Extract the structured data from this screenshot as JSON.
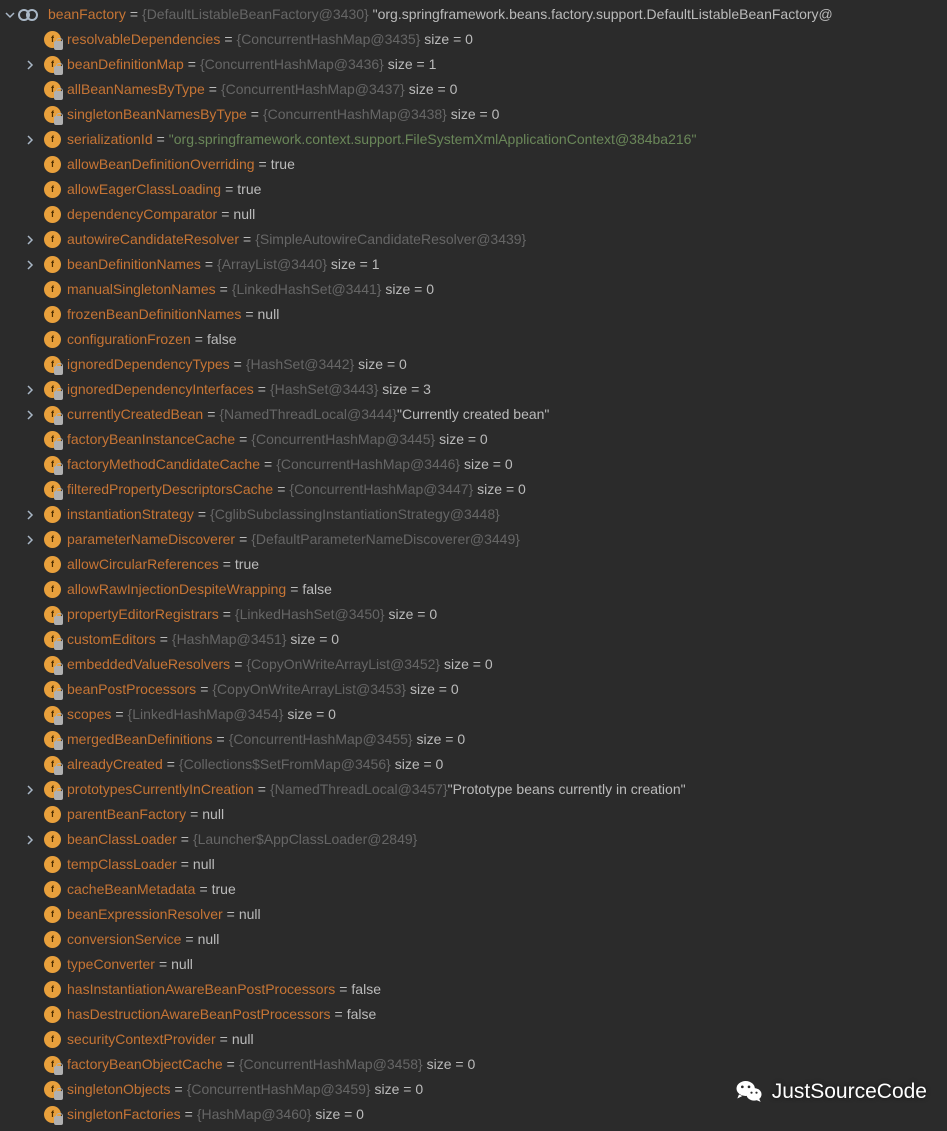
{
  "watermark": "JustSourceCode",
  "root": {
    "name": "beanFactory",
    "ref": "{DefaultListableBeanFactory@3430}",
    "str": "\"org.springframework.beans.factory.support.DefaultListableBeanFactory@"
  },
  "rows": [
    {
      "indent": 42,
      "arrow": false,
      "icon": "fl",
      "name": "resolvableDependencies",
      "ref": "{ConcurrentHashMap@3435}",
      "size": "size = 0"
    },
    {
      "indent": 42,
      "arrow": true,
      "icon": "fl",
      "name": "beanDefinitionMap",
      "ref": "{ConcurrentHashMap@3436}",
      "size": "size = 1"
    },
    {
      "indent": 42,
      "arrow": false,
      "icon": "fl",
      "name": "allBeanNamesByType",
      "ref": "{ConcurrentHashMap@3437}",
      "size": "size = 0"
    },
    {
      "indent": 42,
      "arrow": false,
      "icon": "fl",
      "name": "singletonBeanNamesByType",
      "ref": "{ConcurrentHashMap@3438}",
      "size": "size = 0"
    },
    {
      "indent": 42,
      "arrow": true,
      "icon": "f",
      "name": "serializationId",
      "str": "\"org.springframework.context.support.FileSystemXmlApplicationContext@384ba216\""
    },
    {
      "indent": 42,
      "arrow": false,
      "icon": "f",
      "name": "allowBeanDefinitionOverriding",
      "val": "true"
    },
    {
      "indent": 42,
      "arrow": false,
      "icon": "f",
      "name": "allowEagerClassLoading",
      "val": "true"
    },
    {
      "indent": 42,
      "arrow": false,
      "icon": "f",
      "name": "dependencyComparator",
      "val": "null"
    },
    {
      "indent": 42,
      "arrow": true,
      "icon": "f",
      "name": "autowireCandidateResolver",
      "ref": "{SimpleAutowireCandidateResolver@3439}"
    },
    {
      "indent": 42,
      "arrow": true,
      "icon": "f",
      "name": "beanDefinitionNames",
      "ref": "{ArrayList@3440}",
      "size": "size = 1"
    },
    {
      "indent": 42,
      "arrow": false,
      "icon": "f",
      "name": "manualSingletonNames",
      "ref": "{LinkedHashSet@3441}",
      "size": "size = 0"
    },
    {
      "indent": 42,
      "arrow": false,
      "icon": "f",
      "name": "frozenBeanDefinitionNames",
      "val": "null"
    },
    {
      "indent": 42,
      "arrow": false,
      "icon": "f",
      "name": "configurationFrozen",
      "val": "false"
    },
    {
      "indent": 42,
      "arrow": false,
      "icon": "fl",
      "name": "ignoredDependencyTypes",
      "ref": "{HashSet@3442}",
      "size": "size = 0"
    },
    {
      "indent": 42,
      "arrow": true,
      "icon": "fl",
      "name": "ignoredDependencyInterfaces",
      "ref": "{HashSet@3443}",
      "size": "size = 3"
    },
    {
      "indent": 42,
      "arrow": true,
      "icon": "fl",
      "name": "currentlyCreatedBean",
      "ref": "{NamedThreadLocal@3444}",
      "strgrey": "\"Currently created bean\""
    },
    {
      "indent": 42,
      "arrow": false,
      "icon": "fl",
      "name": "factoryBeanInstanceCache",
      "ref": "{ConcurrentHashMap@3445}",
      "size": "size = 0"
    },
    {
      "indent": 42,
      "arrow": false,
      "icon": "fl",
      "name": "factoryMethodCandidateCache",
      "ref": "{ConcurrentHashMap@3446}",
      "size": "size = 0"
    },
    {
      "indent": 42,
      "arrow": false,
      "icon": "fl",
      "name": "filteredPropertyDescriptorsCache",
      "ref": "{ConcurrentHashMap@3447}",
      "size": "size = 0"
    },
    {
      "indent": 42,
      "arrow": true,
      "icon": "f",
      "name": "instantiationStrategy",
      "ref": "{CglibSubclassingInstantiationStrategy@3448}"
    },
    {
      "indent": 42,
      "arrow": true,
      "icon": "f",
      "name": "parameterNameDiscoverer",
      "ref": "{DefaultParameterNameDiscoverer@3449}"
    },
    {
      "indent": 42,
      "arrow": false,
      "icon": "f",
      "name": "allowCircularReferences",
      "val": "true"
    },
    {
      "indent": 42,
      "arrow": false,
      "icon": "f",
      "name": "allowRawInjectionDespiteWrapping",
      "val": "false"
    },
    {
      "indent": 42,
      "arrow": false,
      "icon": "fl",
      "name": "propertyEditorRegistrars",
      "ref": "{LinkedHashSet@3450}",
      "size": "size = 0"
    },
    {
      "indent": 42,
      "arrow": false,
      "icon": "fl",
      "name": "customEditors",
      "ref": "{HashMap@3451}",
      "size": "size = 0"
    },
    {
      "indent": 42,
      "arrow": false,
      "icon": "fl",
      "name": "embeddedValueResolvers",
      "ref": "{CopyOnWriteArrayList@3452}",
      "size": "size = 0"
    },
    {
      "indent": 42,
      "arrow": false,
      "icon": "fl",
      "name": "beanPostProcessors",
      "ref": "{CopyOnWriteArrayList@3453}",
      "size": "size = 0"
    },
    {
      "indent": 42,
      "arrow": false,
      "icon": "fl",
      "name": "scopes",
      "ref": "{LinkedHashMap@3454}",
      "size": "size = 0"
    },
    {
      "indent": 42,
      "arrow": false,
      "icon": "fl",
      "name": "mergedBeanDefinitions",
      "ref": "{ConcurrentHashMap@3455}",
      "size": "size = 0"
    },
    {
      "indent": 42,
      "arrow": false,
      "icon": "fl",
      "name": "alreadyCreated",
      "ref": "{Collections$SetFromMap@3456}",
      "size": "size = 0"
    },
    {
      "indent": 42,
      "arrow": true,
      "icon": "fl",
      "name": "prototypesCurrentlyInCreation",
      "ref": "{NamedThreadLocal@3457}",
      "strgrey": "\"Prototype beans currently in creation\""
    },
    {
      "indent": 42,
      "arrow": false,
      "icon": "f",
      "name": "parentBeanFactory",
      "val": "null"
    },
    {
      "indent": 42,
      "arrow": true,
      "icon": "f",
      "name": "beanClassLoader",
      "ref": "{Launcher$AppClassLoader@2849}"
    },
    {
      "indent": 42,
      "arrow": false,
      "icon": "f",
      "name": "tempClassLoader",
      "val": "null"
    },
    {
      "indent": 42,
      "arrow": false,
      "icon": "f",
      "name": "cacheBeanMetadata",
      "val": "true"
    },
    {
      "indent": 42,
      "arrow": false,
      "icon": "f",
      "name": "beanExpressionResolver",
      "val": "null"
    },
    {
      "indent": 42,
      "arrow": false,
      "icon": "f",
      "name": "conversionService",
      "val": "null"
    },
    {
      "indent": 42,
      "arrow": false,
      "icon": "f",
      "name": "typeConverter",
      "val": "null"
    },
    {
      "indent": 42,
      "arrow": false,
      "icon": "f",
      "name": "hasInstantiationAwareBeanPostProcessors",
      "val": "false"
    },
    {
      "indent": 42,
      "arrow": false,
      "icon": "f",
      "name": "hasDestructionAwareBeanPostProcessors",
      "val": "false"
    },
    {
      "indent": 42,
      "arrow": false,
      "icon": "f",
      "name": "securityContextProvider",
      "val": "null"
    },
    {
      "indent": 42,
      "arrow": false,
      "icon": "fl",
      "name": "factoryBeanObjectCache",
      "ref": "{ConcurrentHashMap@3458}",
      "size": "size = 0"
    },
    {
      "indent": 42,
      "arrow": false,
      "icon": "fl",
      "name": "singletonObjects",
      "ref": "{ConcurrentHashMap@3459}",
      "size": "size = 0"
    },
    {
      "indent": 42,
      "arrow": false,
      "icon": "fl",
      "name": "singletonFactories",
      "ref": "{HashMap@3460}",
      "size": "size = 0"
    }
  ]
}
